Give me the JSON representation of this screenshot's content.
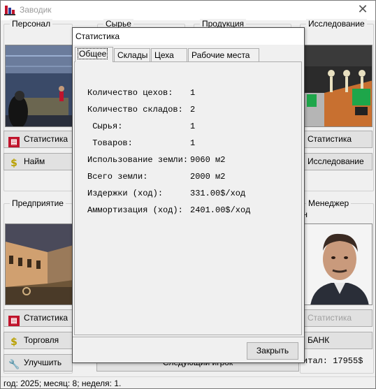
{
  "window": {
    "title": "Заводик",
    "icon": "factory-icon",
    "close_glyph": "✕"
  },
  "groups": {
    "personnel": "Персонал",
    "raw": "Сырье",
    "products": "Продукция",
    "research": "Исследование",
    "enterprise": "Предприятие",
    "manager": "Менеджер"
  },
  "background_buttons": {
    "personnel_stats": "Статистика",
    "hire": "Найм",
    "research_stats": "Статистика",
    "research": "Исследование",
    "enterprise_stats": "Статистика",
    "trade": "Торговля",
    "improve": "Улучшить",
    "manager_stats": "Статистика",
    "bank": "БАНК",
    "next_player": "Следующий игрок"
  },
  "manager_name_fragment": "н",
  "capital_text": "итал: 17955$",
  "status_bar": "год: 2025; месяц: 8; неделя: 1.",
  "dialog": {
    "title": "Статистика",
    "tabs": [
      "Общее",
      "Склады",
      "Цеха",
      "Рабочие места"
    ],
    "active_tab": "Общее",
    "rows": [
      {
        "label": "Количество цехов:",
        "value": "1"
      },
      {
        "label": "Количество складов:",
        "value": "2"
      },
      {
        "label": " Сырья:",
        "value": "1"
      },
      {
        "label": " Товаров:",
        "value": "1"
      },
      {
        "label": "Использование земли:",
        "value": "9060 м2"
      },
      {
        "label": "Всего земли:",
        "value": "2000 м2"
      },
      {
        "label": "Издержки (ход):",
        "value": "331.00$/ход"
      },
      {
        "label": "Аммортизация (ход):",
        "value": "2401.00$/ход"
      }
    ],
    "close_label": "Закрыть"
  },
  "colors": {
    "accent_red": "#c0142c",
    "dollar_gold": "#b9a000",
    "window_bg": "#f0f0f0"
  }
}
